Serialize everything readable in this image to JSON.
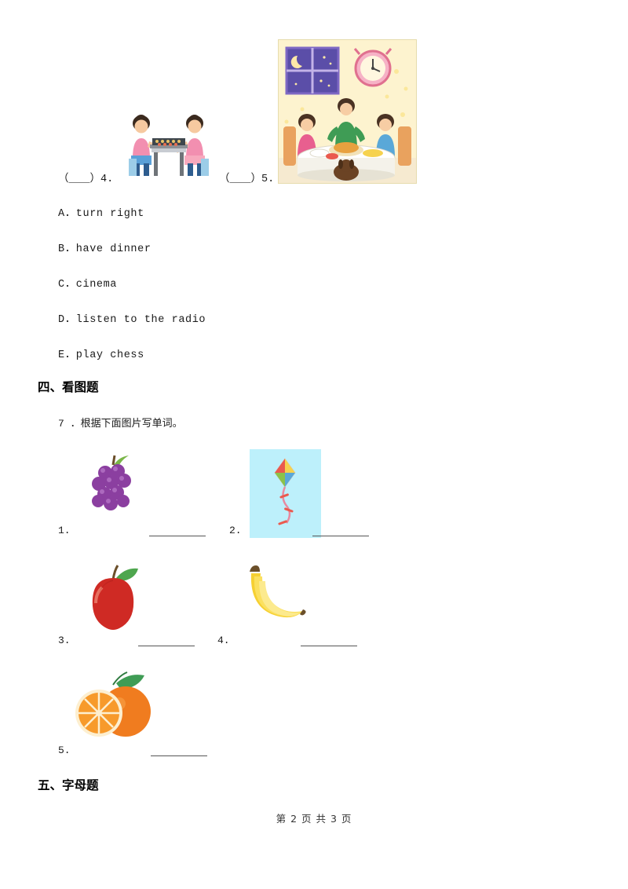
{
  "document": {
    "footer": "第 2 页 共 3 页"
  },
  "matching": {
    "items": [
      {
        "label": "（＿＿）4.",
        "picture": "chess-picture"
      },
      {
        "label": "（＿＿）5.",
        "picture": "dinner-picture"
      }
    ],
    "options": [
      "A．turn right",
      "B．have dinner",
      "C．cinema",
      "D．listen to the radio",
      "E．play chess"
    ]
  },
  "section_four": {
    "heading": "四、看图题",
    "question": "7 ．根据下面图片写单词。",
    "items": [
      {
        "num": "1.",
        "picture": "grapes-picture",
        "answer": ""
      },
      {
        "num": "2.",
        "picture": "kite-picture",
        "answer": ""
      },
      {
        "num": "3.",
        "picture": "apple-picture",
        "answer": ""
      },
      {
        "num": "4.",
        "picture": "banana-picture",
        "answer": ""
      },
      {
        "num": "5.",
        "picture": "orange-picture",
        "answer": ""
      }
    ]
  },
  "section_five": {
    "heading": "五、字母题"
  },
  "colors": {
    "text": "#1a1a1a",
    "heading": "#000000",
    "rule": "#555555",
    "kite_bg": "#bdf0fb",
    "dinner_bg": "#fdf6d8"
  }
}
